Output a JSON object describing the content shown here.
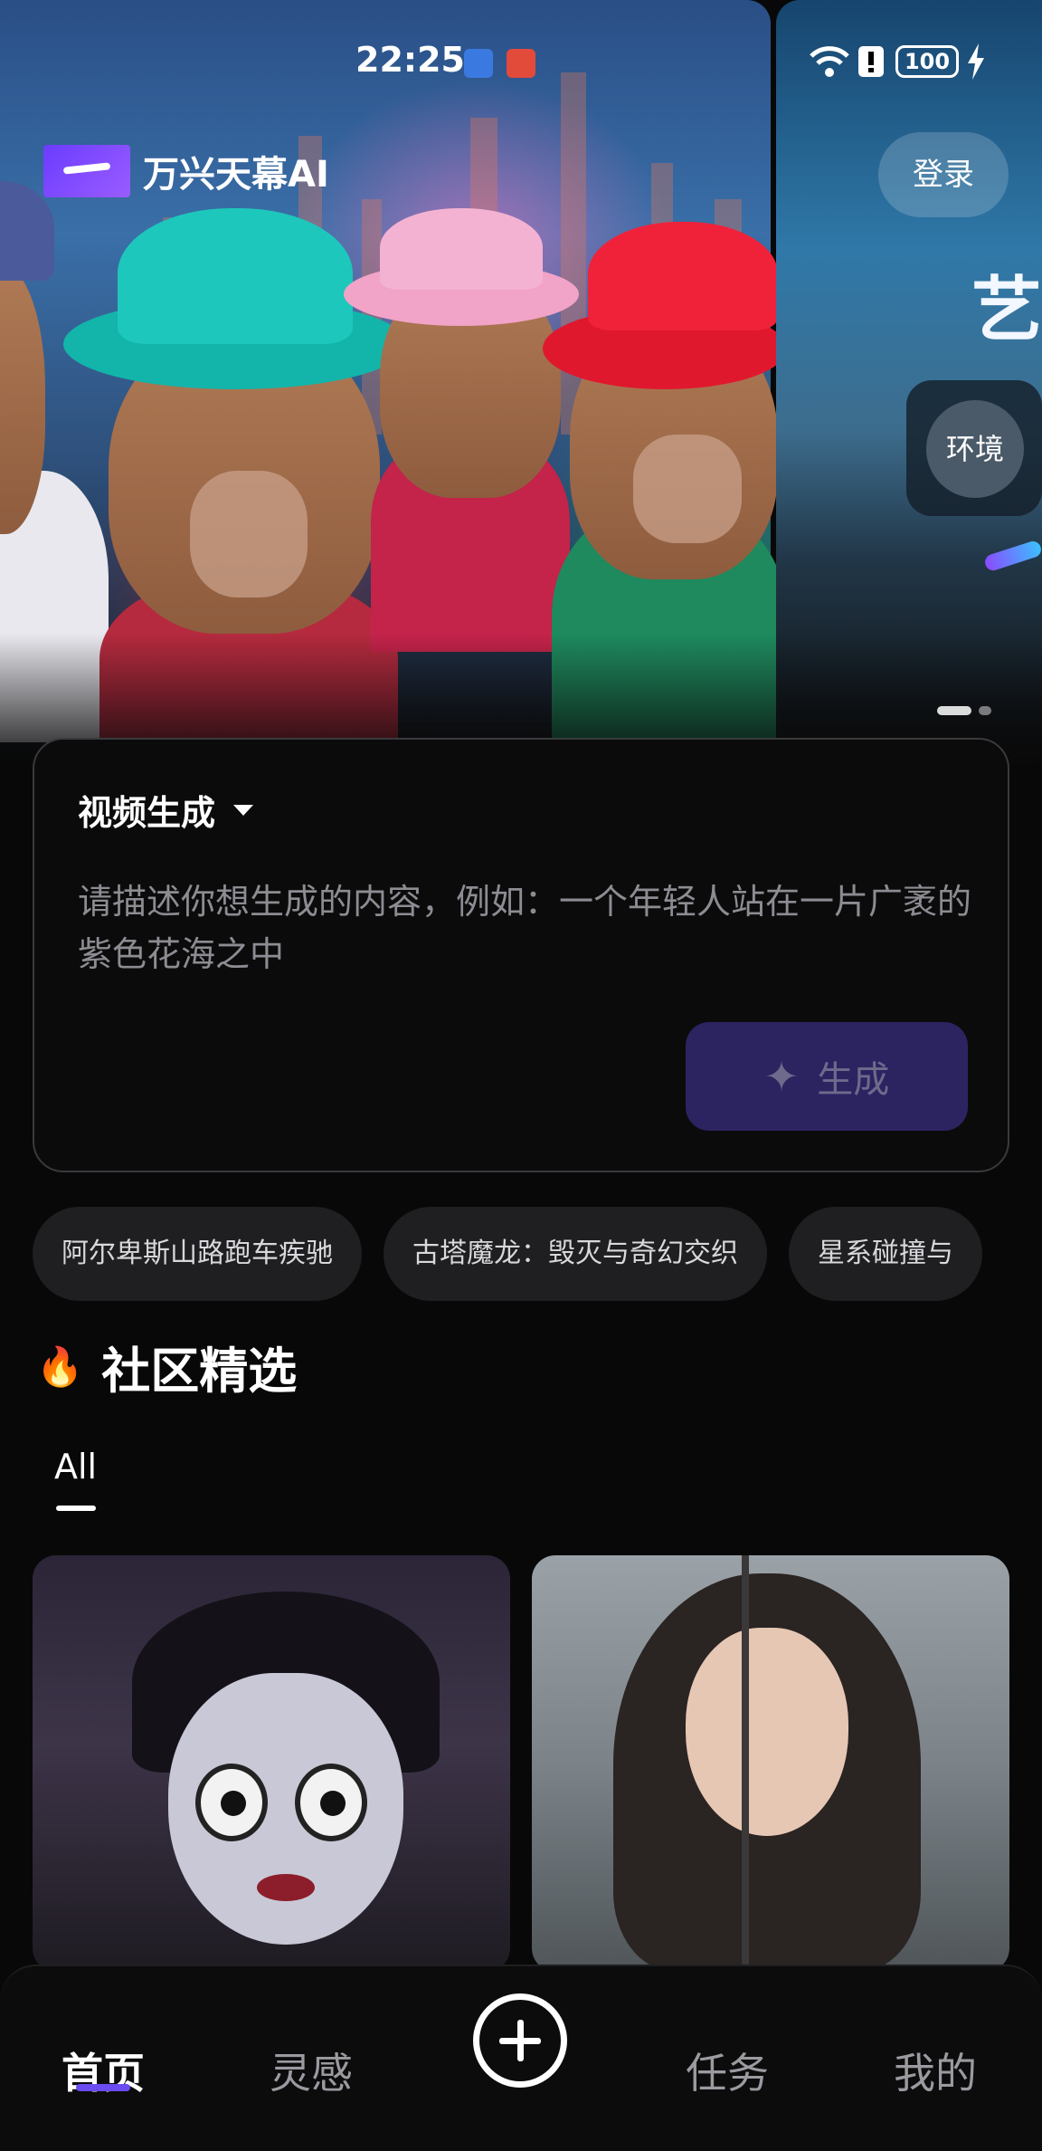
{
  "status_bar": {
    "time": "22:25",
    "battery": "100",
    "icons": [
      "usb-icon",
      "notification-icon",
      "wifi-icon",
      "alert-icon",
      "battery-icon",
      "charging-icon"
    ]
  },
  "header": {
    "app_name": "万兴天幕AI",
    "login_label": "登录"
  },
  "banner": {
    "slide2_text": "艺",
    "slide2_chip": "环境",
    "slide_count": 2,
    "active_slide": 1
  },
  "prompt": {
    "mode_label": "视频生成",
    "placeholder": "请描述你想生成的内容，例如：一个年轻人站在一片广袤的紫色花海之中",
    "generate_label": "生成"
  },
  "suggestions": [
    "阿尔卑斯山路跑车疾驰",
    "古塔魔龙：毁灭与奇幻交织",
    "星系碰撞与"
  ],
  "community": {
    "title": "社区精选",
    "filters": [
      "All"
    ],
    "active_filter": "All"
  },
  "bottom_nav": {
    "items": [
      "首页",
      "灵感",
      "任务",
      "我的"
    ],
    "active": "首页"
  },
  "colors": {
    "background": "#080808",
    "accent": "#6a4cf0",
    "generate_button": "#2c2461",
    "chip": "#1f1f22"
  }
}
